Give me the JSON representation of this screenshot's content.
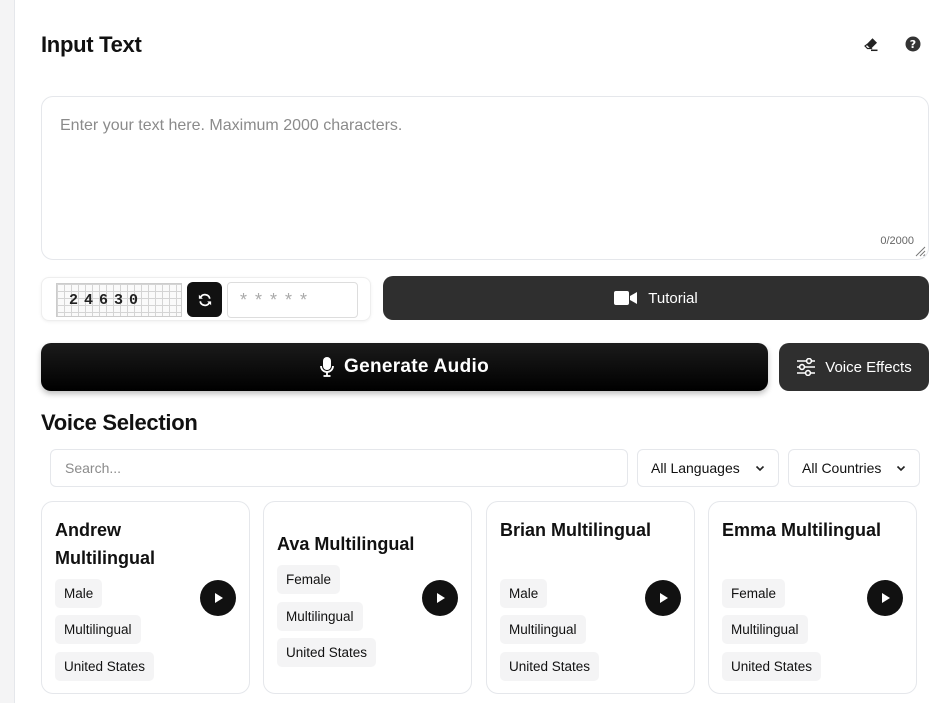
{
  "input": {
    "title": "Input Text",
    "placeholder": "Enter your text here. Maximum 2000 characters.",
    "char_count": "0/2000"
  },
  "captcha": {
    "code": "24630",
    "input_placeholder": "*****"
  },
  "buttons": {
    "tutorial": "Tutorial",
    "generate": "Generate Audio",
    "voice_effects": "Voice Effects"
  },
  "voice_selection": {
    "title": "Voice Selection",
    "search_placeholder": "Search...",
    "language_filter": "All Languages",
    "country_filter": "All Countries",
    "voices": [
      {
        "name": "Andrew Multilingual",
        "gender": "Male",
        "type": "Multilingual",
        "country": "United States"
      },
      {
        "name": "Ava Multilingual",
        "gender": "Female",
        "type": "Multilingual",
        "country": "United States"
      },
      {
        "name": "Brian Multilingual",
        "gender": "Male",
        "type": "Multilingual",
        "country": "United States"
      },
      {
        "name": "Emma Multilingual",
        "gender": "Female",
        "type": "Multilingual",
        "country": "United States"
      }
    ]
  },
  "colors": {
    "primary": "#111111",
    "secondary_button": "#2f2f2f",
    "tag_bg": "#f4f4f5",
    "border": "#e5e7eb"
  },
  "icons": [
    "eraser-icon",
    "help-icon",
    "refresh-icon",
    "video-camera-icon",
    "microphone-icon",
    "sliders-icon",
    "chevron-down-icon",
    "play-icon"
  ]
}
